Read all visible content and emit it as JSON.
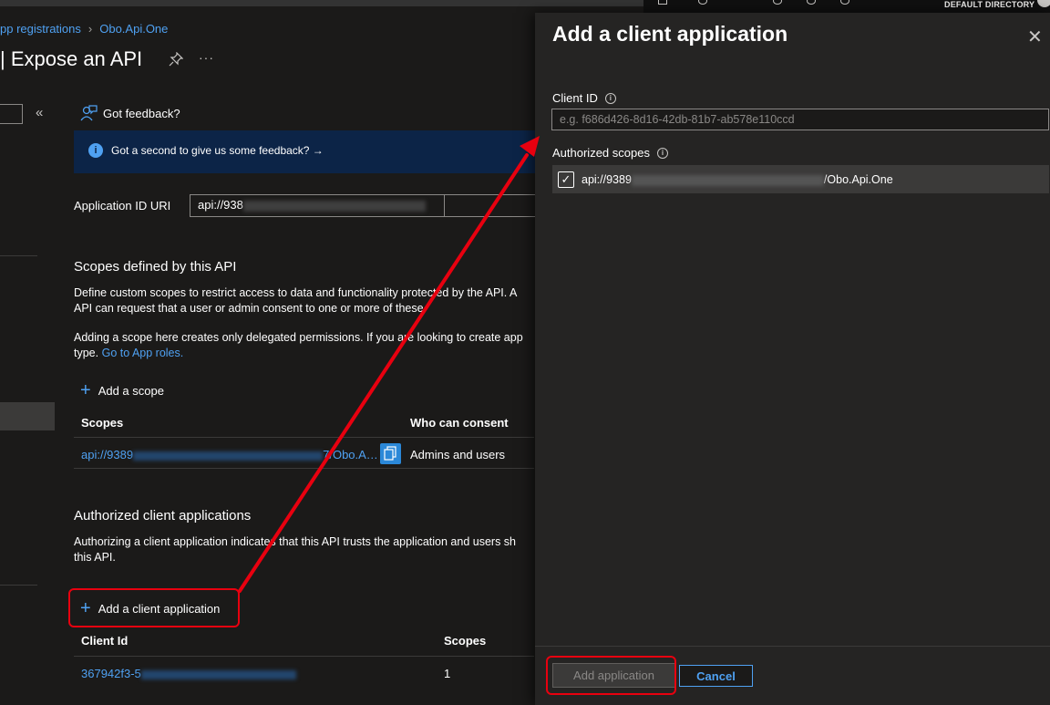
{
  "topbar": {
    "directory": "DEFAULT DIRECTORY"
  },
  "breadcrumb": {
    "item1": "pp registrations",
    "item2": "Obo.Api.One"
  },
  "page": {
    "title": "| Expose an API",
    "more": "···"
  },
  "nav": {
    "collapse": "«"
  },
  "feedback": {
    "label": "Got feedback?",
    "banner_text": "Got a second to give us some feedback? →"
  },
  "app_id_uri": {
    "label": "Application ID URI",
    "value_prefix": "api://938"
  },
  "scopes_section": {
    "title": "Scopes defined by this API",
    "para1": "Define custom scopes to restrict access to data and functionality protected by the API. A",
    "para1b": "API can request that a user or admin consent to one or more of these.",
    "para2": "Adding a scope here creates only delegated permissions. If you are looking to create app",
    "para2b_prefix": "type.",
    "para2b_link": "Go to App roles.",
    "add_label": "Add a scope",
    "col_scopes": "Scopes",
    "col_consent": "Who can consent",
    "rows": [
      {
        "scope_prefix": "api://9389",
        "scope_suffix": "7/Obo.A…",
        "consent": "Admins and users"
      }
    ]
  },
  "clients_section": {
    "title": "Authorized client applications",
    "para1": "Authorizing a client application indicates that this API trusts the application and users sh",
    "para1b": "this API.",
    "add_label": "Add a client application",
    "col_clientid": "Client Id",
    "col_scopes": "Scopes",
    "rows": [
      {
        "client_prefix": "367942f3-5",
        "scopes": "1"
      }
    ]
  },
  "panel": {
    "title": "Add a client application",
    "close": "✕",
    "client_id_label": "Client ID",
    "client_id_placeholder": "e.g. f686d426-8d16-42db-81b7-ab578e110ccd",
    "client_id_value": "",
    "authorized_scopes_label": "Authorized scopes",
    "scope_prefix": "api://9389",
    "scope_suffix": "/Obo.Api.One",
    "scope_checked": true,
    "add_button": "Add application",
    "cancel_button": "Cancel"
  },
  "colors": {
    "background": "#1b1a19",
    "panel": "#252423",
    "link": "#4fa1f2",
    "banner": "#0c2447",
    "annotation": "#e8000f"
  }
}
